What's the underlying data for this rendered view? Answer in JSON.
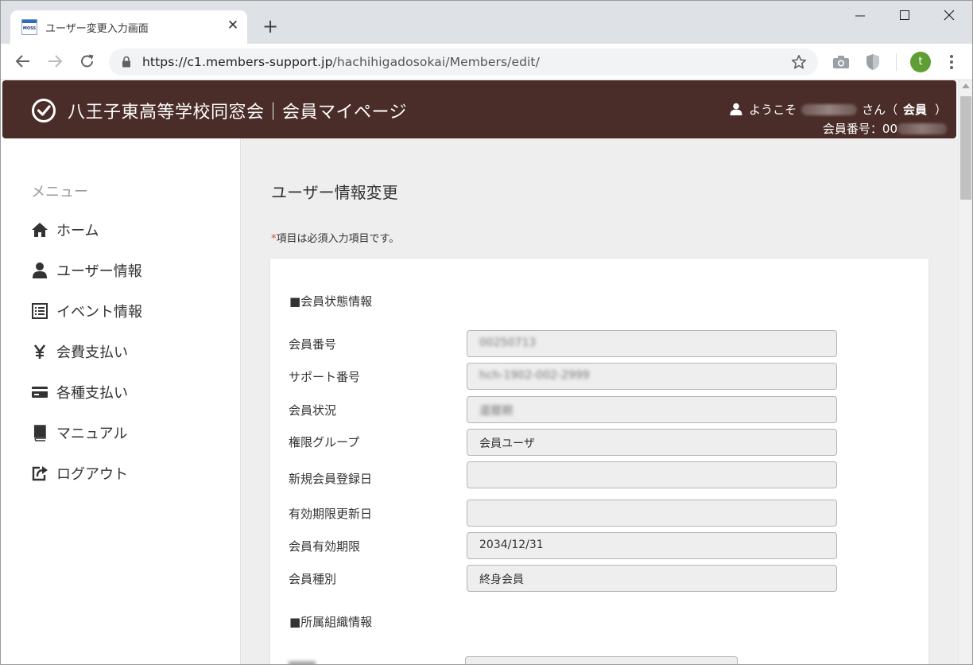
{
  "browser": {
    "tab_title": "ユーザー変更入力画面",
    "favicon_text": "MOSS",
    "url_host": "https://c1.members-support.jp",
    "url_path": "/hachihigadosokai/Members/edit/",
    "profile_initial": "t"
  },
  "header": {
    "site_title": "八王子東高等学校同窓会｜会員マイページ",
    "welcome_prefix": "ようこそ",
    "welcome_suffix": "さん（",
    "user_role": "会員",
    "role_close": "）",
    "member_no_label": "会員番号：00"
  },
  "sidebar": {
    "menu_heading": "メニュー",
    "items": [
      {
        "label": "ホーム",
        "icon": "home-icon"
      },
      {
        "label": "ユーザー情報",
        "icon": "user-icon"
      },
      {
        "label": "イベント情報",
        "icon": "list-icon"
      },
      {
        "label": "会費支払い",
        "icon": "yen-icon"
      },
      {
        "label": "各種支払い",
        "icon": "credit-card-icon"
      },
      {
        "label": "マニュアル",
        "icon": "book-icon"
      },
      {
        "label": "ログアウト",
        "icon": "logout-icon"
      }
    ]
  },
  "main": {
    "page_title": "ユーザー情報変更",
    "required_star": "*",
    "required_note": "項目は必須入力項目です。",
    "section_status": "■会員状態情報",
    "section_org": "■所属組織情報",
    "fields": [
      {
        "label": "会員番号",
        "value": "00250713"
      },
      {
        "label": "サポート番号",
        "value": "hch-1902-002-2999"
      },
      {
        "label": "会員状況",
        "value": "還暦期"
      },
      {
        "label": "権限グループ",
        "value": "会員ユーザ"
      },
      {
        "label": "新規会員登録日",
        "value": ""
      },
      {
        "label": "有効期限更新日",
        "value": ""
      },
      {
        "label": "会員有効期限",
        "value": "2034/12/31"
      },
      {
        "label": "会員種別",
        "value": "終身会員"
      }
    ]
  },
  "colors": {
    "header_bg": "#4a2c28",
    "main_bg": "#eeeeee",
    "required_star": "#e0403c",
    "profile_avatar": "#5f9e34"
  }
}
